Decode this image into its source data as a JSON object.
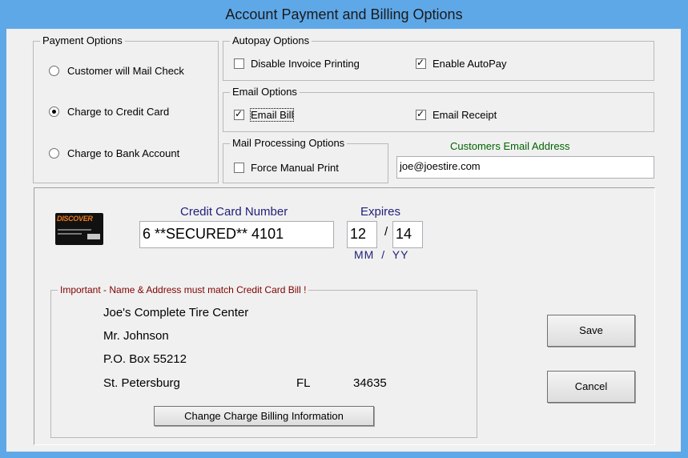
{
  "window": {
    "title": "Account Payment and Billing Options"
  },
  "payment_options": {
    "title": "Payment Options",
    "options": [
      {
        "label": "Customer will Mail Check",
        "selected": false
      },
      {
        "label": "Charge to Credit Card",
        "selected": true
      },
      {
        "label": "Charge to Bank Account",
        "selected": false
      }
    ]
  },
  "autopay_options": {
    "title": "Autopay Options",
    "disable_invoice_printing": {
      "label": "Disable Invoice Printing",
      "checked": false
    },
    "enable_autopay": {
      "label": "Enable AutoPay",
      "checked": true
    }
  },
  "email_options": {
    "title": "Email Options",
    "email_bill": {
      "label": "Email Bill",
      "checked": true
    },
    "email_receipt": {
      "label": "Email Receipt",
      "checked": true
    }
  },
  "mail_processing_options": {
    "title": "Mail Processing Options",
    "force_manual_print": {
      "label": "Force Manual Print",
      "checked": false
    }
  },
  "customer_email": {
    "label": "Customers Email Address",
    "value": "joe@joestire.com"
  },
  "credit_card": {
    "number_label": "Credit Card Number",
    "number_value": "6 **SECURED** 4101",
    "expires_label": "Expires",
    "exp_month": "12",
    "exp_separator": "/",
    "exp_year": "14",
    "format_hint_mm": "MM",
    "format_hint_sep": "/",
    "format_hint_yy": "YY",
    "card_logo": {
      "brand": "DISCOVER",
      "icon": "discover-card-icon"
    }
  },
  "billing_address": {
    "title": "Important - Name & Address must match Credit Card Bill !",
    "company": "Joe's Complete Tire Center",
    "contact": "Mr. Johnson",
    "address": "P.O. Box 55212",
    "city": "St. Petersburg",
    "state": "FL",
    "zip": "34635",
    "change_button": "Change Charge Billing Information"
  },
  "actions": {
    "save": "Save",
    "cancel": "Cancel"
  },
  "colors": {
    "titlebar": "#5fa8e8",
    "dialog_bg": "#f0f0f0",
    "email_label": "#006400",
    "cc_label": "#1f1f7a",
    "important_label": "#800000"
  }
}
